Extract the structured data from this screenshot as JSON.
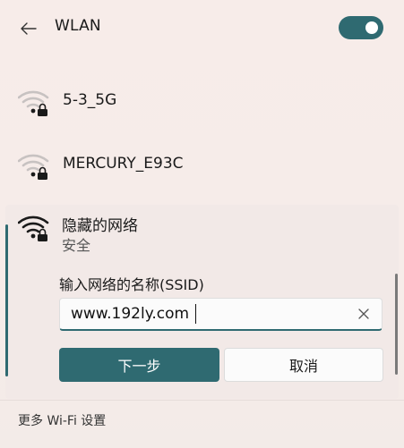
{
  "header": {
    "title": "WLAN",
    "back_icon": "back-arrow-icon",
    "toggle_on": true,
    "accent_color": "#2f6a71"
  },
  "networks": [
    {
      "name": "5-3_5G",
      "icon": "wifi-secured-icon"
    },
    {
      "name": "MERCURY_E93C",
      "icon": "wifi-secured-icon"
    }
  ],
  "hidden_network": {
    "name": "隐藏的网络",
    "security": "安全",
    "ssid_label": "输入网络的名称(SSID)",
    "ssid_value": "www.192ly.com",
    "clear_icon": "clear-icon",
    "next_label": "下一步",
    "cancel_label": "取消"
  },
  "footer": {
    "more_label": "更多 Wi-Fi 设置"
  }
}
